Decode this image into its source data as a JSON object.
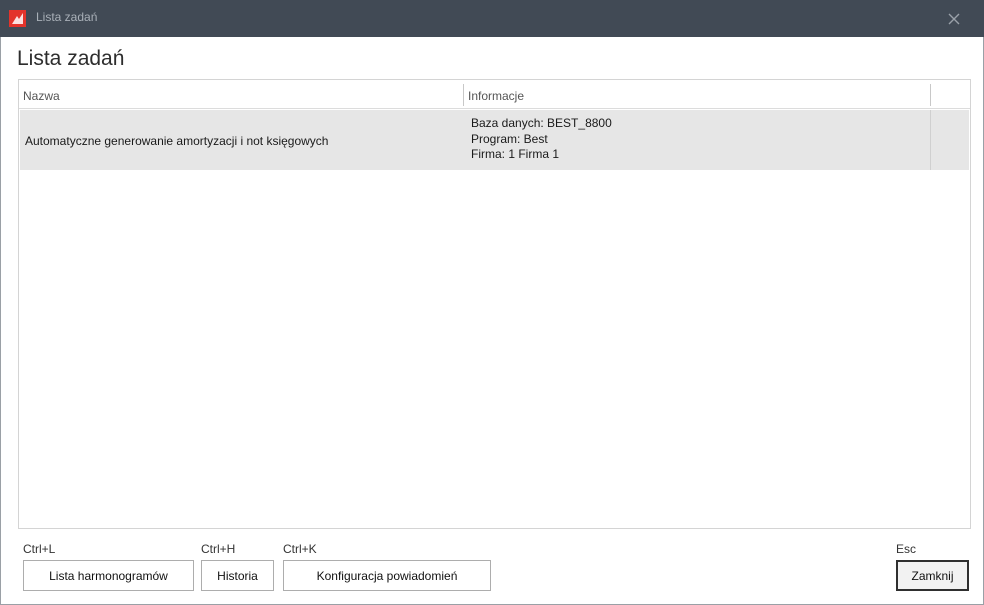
{
  "window": {
    "title": "Lista zadań",
    "app_icon": "app-logo-icon",
    "close_icon": "close-icon"
  },
  "page": {
    "title": "Lista zadań"
  },
  "grid": {
    "columns": [
      "Nazwa",
      "Informacje"
    ],
    "rows": [
      {
        "nazwa": "Automatyczne generowanie amortyzacji i not księgowych",
        "info": [
          "Baza danych: BEST_8800",
          "Program: Best",
          "Firma: 1 Firma 1"
        ]
      }
    ]
  },
  "footer": {
    "buttons": [
      {
        "shortcut": "Ctrl+L",
        "label": "Lista harmonogramów"
      },
      {
        "shortcut": "Ctrl+H",
        "label": "Historia"
      },
      {
        "shortcut": "Ctrl+K",
        "label": "Konfiguracja powiadomień"
      }
    ],
    "close": {
      "shortcut": "Esc",
      "label": "Zamknij"
    }
  },
  "colors": {
    "titlebar": "#414a55",
    "selected_row": "#e6e6e6",
    "accent_icon": "#e3332b"
  }
}
